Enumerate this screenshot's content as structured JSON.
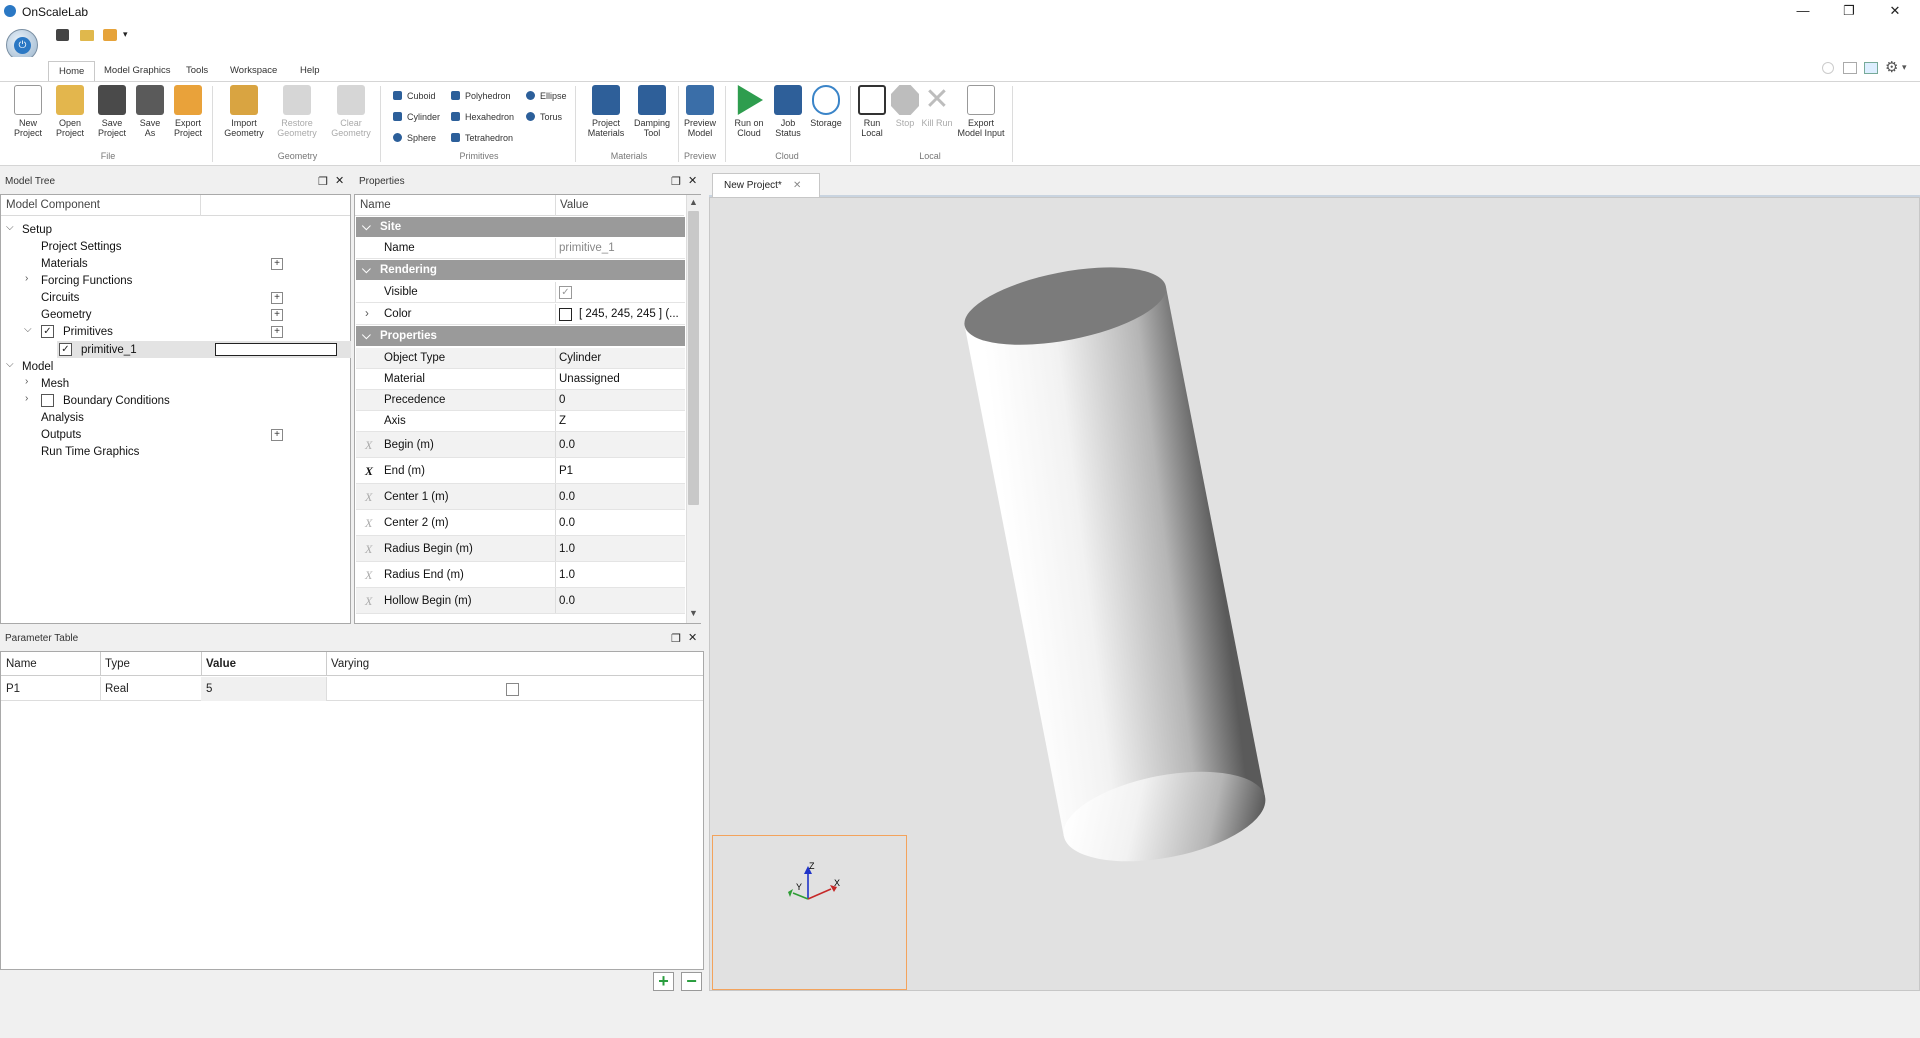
{
  "app": {
    "title": "OnScaleLab",
    "orb_icon": "power-icon",
    "accent": "#2b78c4"
  },
  "window_controls": {
    "minimize": "—",
    "restore": "❐",
    "close": "✕"
  },
  "ribbon_tabs": [
    "Home",
    "Model Graphics",
    "Tools",
    "Workspace",
    "Help"
  ],
  "ribbon": {
    "file": {
      "label": "File",
      "new": "New Project",
      "open": "Open Project",
      "save": "Save Project",
      "save_as": "Save As",
      "export": "Export Project"
    },
    "geometry": {
      "label": "Geometry",
      "import": "Import Geometry",
      "restore": "Restore Geometry",
      "clear": "Clear Geometry"
    },
    "primitives": {
      "label": "Primitives",
      "items": [
        "Cuboid",
        "Cylinder",
        "Sphere",
        "Polyhedron",
        "Hexahedron",
        "Tetrahedron",
        "Ellipse",
        "Torus"
      ]
    },
    "materials": {
      "label": "Materials",
      "project": "Project Materials",
      "damping": "Damping Tool"
    },
    "preview": {
      "label": "Preview",
      "model": "Preview Model"
    },
    "cloud": {
      "label": "Cloud",
      "run": "Run on Cloud",
      "status": "Job Status",
      "storage": "Storage"
    },
    "local": {
      "label": "Local",
      "run": "Run Local",
      "stop": "Stop",
      "kill": "Kill Run",
      "export": "Export Model Input"
    }
  },
  "model_tree": {
    "title": "Model Tree",
    "col1": "Model Component",
    "items": {
      "setup": "Setup",
      "project_settings": "Project Settings",
      "materials": "Materials",
      "forcing": "Forcing Functions",
      "circuits": "Circuits",
      "geometry": "Geometry",
      "primitives": "Primitives",
      "primitive_1": "primitive_1",
      "model": "Model",
      "mesh": "Mesh",
      "boundary": "Boundary Conditions",
      "analysis": "Analysis",
      "outputs": "Outputs",
      "rtg": "Run Time Graphics"
    }
  },
  "properties": {
    "title": "Properties",
    "col_name": "Name",
    "col_value": "Value",
    "sec_site": "Site",
    "sec_rendering": "Rendering",
    "sec_properties": "Properties",
    "rows": {
      "name": {
        "n": "Name",
        "v": "primitive_1"
      },
      "visible": {
        "n": "Visible",
        "v": "✓"
      },
      "color": {
        "n": "Color",
        "v": "[ 245, 245, 245 ] (..."
      },
      "type": {
        "n": "Object Type",
        "v": "Cylinder"
      },
      "material": {
        "n": "Material",
        "v": "Unassigned"
      },
      "precedence": {
        "n": "Precedence",
        "v": "0"
      },
      "axis": {
        "n": "Axis",
        "v": "Z"
      },
      "begin": {
        "n": "Begin (m)",
        "v": "0.0"
      },
      "end": {
        "n": "End (m)",
        "v": "P1"
      },
      "c1": {
        "n": "Center 1 (m)",
        "v": "0.0"
      },
      "c2": {
        "n": "Center 2 (m)",
        "v": "0.0"
      },
      "rb": {
        "n": "Radius Begin (m)",
        "v": "1.0"
      },
      "re": {
        "n": "Radius End (m)",
        "v": "1.0"
      },
      "hb": {
        "n": "Hollow Begin (m)",
        "v": "0.0"
      }
    },
    "x_glyph": "X"
  },
  "param_table": {
    "title": "Parameter Table",
    "headers": [
      "Name",
      "Type",
      "Value",
      "Varying"
    ],
    "row": {
      "name": "P1",
      "type": "Real",
      "value": "5"
    },
    "add": "+",
    "remove": "−"
  },
  "doc_tab": {
    "label": "New Project*",
    "close": "✕"
  },
  "axes": {
    "z": "Z",
    "y": "Y",
    "x": "X"
  }
}
